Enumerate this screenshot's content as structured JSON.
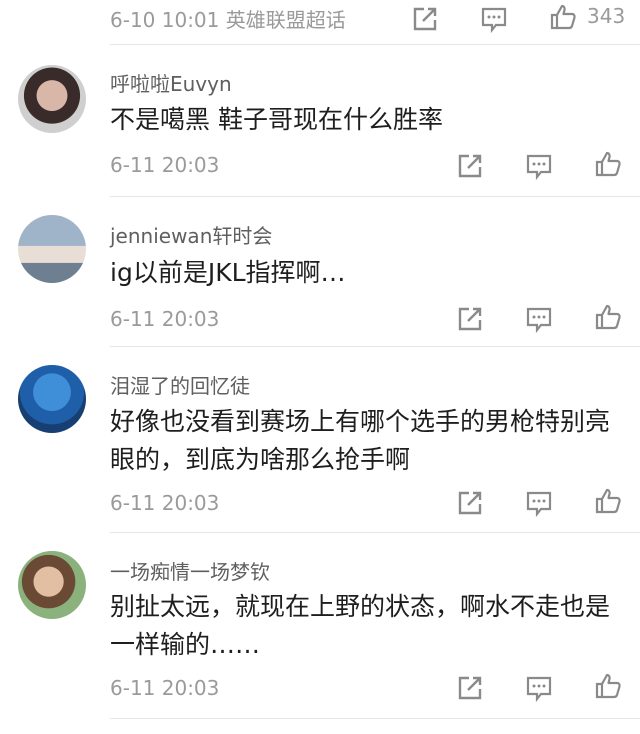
{
  "top": {
    "time_topic": "6-10 10:01 英雄联盟超话",
    "like_count": "343"
  },
  "comments": [
    {
      "username": "呼啦啦Euvyn",
      "text": "不是噶黑 鞋子哥现在什么胜率",
      "time": "6-11 20:03",
      "avatar_icon": "user-avatar-icon"
    },
    {
      "username": "jenniewan轩时会",
      "text": "ig以前是JKL指挥啊…",
      "time": "6-11 20:03",
      "avatar_icon": "user-avatar-icon"
    },
    {
      "username": "泪湿了的回忆徒",
      "text": "好像也没看到赛场上有哪个选手的男枪特别亮眼的，到底为啥那么抢手啊",
      "time": "6-11 20:03",
      "avatar_icon": "user-avatar-icon"
    },
    {
      "username": "一场痴情一场梦钦",
      "text": "别扯太远，就现在上野的状态，啊水不走也是一样输的……",
      "time": "6-11 20:03",
      "avatar_icon": "user-avatar-icon"
    }
  ],
  "icons": {
    "repost": "repost-icon",
    "comment": "comment-icon",
    "like": "thumbs-up-icon"
  },
  "colors": {
    "meta_gray": "#9a9a9a",
    "icon_gray": "#8a8a8a",
    "divider": "#e6e6e6"
  }
}
